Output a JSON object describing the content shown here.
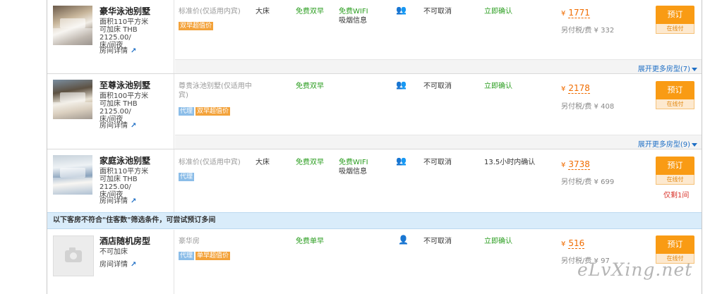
{
  "rooms": [
    {
      "name": "豪华泳池别墅",
      "info": [
        "面积110平方米",
        "可加床 THB 2125.00/",
        "床/间夜"
      ],
      "detail": "房间详情",
      "plan": "标准价(仅适用内宾)",
      "tags": [
        {
          "label": "双早超值价",
          "color": "orange"
        }
      ],
      "bed": "大床",
      "breakfast": "免费双早",
      "wifi": "免费WIFI",
      "smoking": "吸烟信息",
      "cancel": "不可取消",
      "confirm": "立即确认",
      "price": "1771",
      "tax": "另付税/费 ¥ 332",
      "book": "预订",
      "book_sub": "在线付",
      "expand": "展开更多房型(7)"
    },
    {
      "name": "至尊泳池别墅",
      "info": [
        "面积100平方米",
        "可加床 THB 2125.00/",
        "床/间夜"
      ],
      "detail": "房间详情",
      "plan": "尊贵泳池别墅(仅适用中宾)",
      "plan_lines": [
        "尊贵泳池别墅(仅适用中",
        "宾)"
      ],
      "tags": [
        {
          "label": "代理",
          "color": "blue"
        },
        {
          "label": "双早超值价",
          "color": "orange"
        }
      ],
      "bed": "",
      "breakfast": "免费双早",
      "wifi": "",
      "smoking": "",
      "cancel": "不可取消",
      "confirm": "立即确认",
      "price": "2178",
      "tax": "另付税/费 ¥ 408",
      "book": "预订",
      "book_sub": "在线付",
      "expand": "展开更多房型(9)"
    },
    {
      "name": "家庭泳池别墅",
      "info": [
        "面积110平方米",
        "可加床 THB 2125.00/",
        "床/间夜"
      ],
      "detail": "房间详情",
      "plan": "标准价(仅适用中宾)",
      "tags": [
        {
          "label": "代理",
          "color": "blue"
        }
      ],
      "bed": "大床",
      "breakfast": "免费双早",
      "wifi": "免费WIFI",
      "smoking": "吸烟信息",
      "cancel": "不可取消",
      "confirm": "13.5小时内确认",
      "price": "3738",
      "tax": "另付税/费 ¥ 699",
      "book": "预订",
      "book_sub": "在线付",
      "limit": "仅剩1间"
    },
    {
      "name": "酒店随机房型",
      "info": [
        "不可加床"
      ],
      "detail": "房间详情",
      "plan": "豪华房",
      "tags": [
        {
          "label": "代理",
          "color": "blue"
        },
        {
          "label": "单早超值价",
          "color": "orange"
        }
      ],
      "bed": "",
      "breakfast": "免费单早",
      "cancel": "不可取消",
      "confirm": "立即确认",
      "price": "516",
      "tax": "另付税/费 ¥ 97",
      "book": "预订",
      "book_sub": "在线付"
    }
  ],
  "notice": "以下客房不符合\"住客数\"筛选条件，可尝试预订多间",
  "currency": "¥",
  "watermark": "eLvXing.net",
  "colors": {
    "accent": "#f99b14",
    "link": "#1f6fc5",
    "green": "#2a9d1f",
    "notice_bg": "#d9ecfa"
  }
}
